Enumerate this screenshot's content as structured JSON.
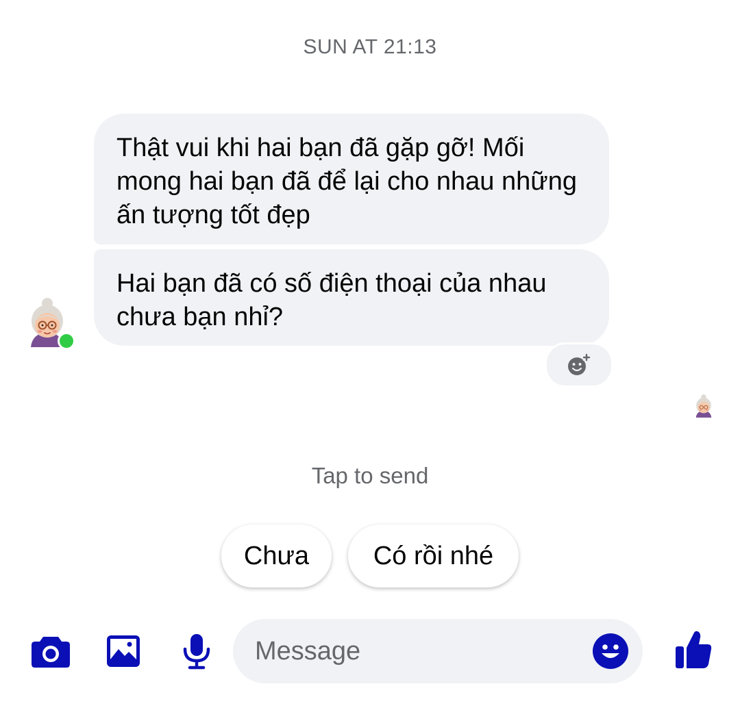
{
  "thread": {
    "timestamp": "SUN AT 21:13",
    "messages": [
      {
        "text": "Thật vui khi hai bạn đã gặp gỡ! Mối mong hai bạn đã để lại cho nhau những ấn tượng tốt đẹp"
      },
      {
        "text": "Hai bạn đã có số điện thoại của nhau chưa bạn nhỉ?"
      }
    ],
    "sender": {
      "avatar_icon": "grandmother-avatar-icon",
      "online": true
    },
    "seen_avatar_icon": "grandmother-avatar-icon",
    "react_icon": "add-reaction-icon"
  },
  "quick_replies": {
    "hint": "Tap to send",
    "options": [
      "Chưa",
      "Có rồi nhé"
    ]
  },
  "composer": {
    "placeholder": "Message",
    "icons": [
      "camera-icon",
      "image-icon",
      "microphone-icon",
      "emoji-icon",
      "thumbs-up-icon"
    ]
  },
  "colors": {
    "accent": "#0a10b5",
    "bubble_bg": "#f0f2f5",
    "secondary_text": "#65676b",
    "online": "#31cc46"
  }
}
